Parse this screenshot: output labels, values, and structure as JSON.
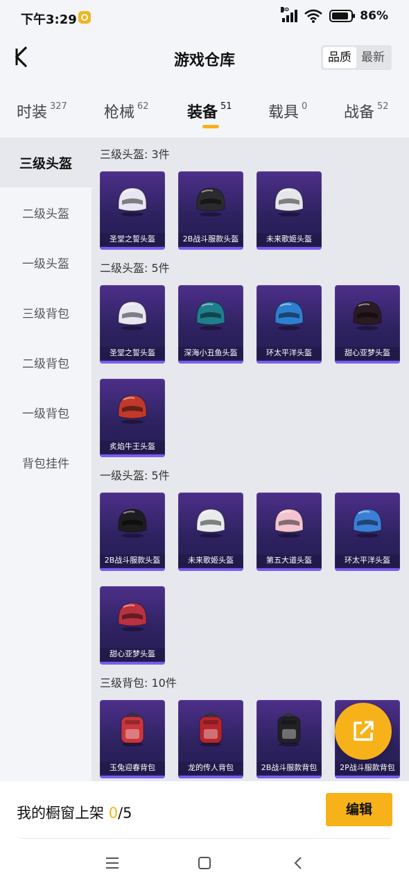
{
  "status_bar": {
    "time": "下午3:29",
    "battery": "86%"
  },
  "header": {
    "title": "游戏仓库",
    "sort_options": [
      "品质",
      "最新"
    ],
    "active_sort": "品质"
  },
  "category_tabs": [
    {
      "label": "时装",
      "count": "327"
    },
    {
      "label": "枪械",
      "count": "62"
    },
    {
      "label": "装备",
      "count": "51"
    },
    {
      "label": "载具",
      "count": "0"
    },
    {
      "label": "战备",
      "count": "52"
    }
  ],
  "sidebar": {
    "items": [
      "三级头盔",
      "二级头盔",
      "一级头盔",
      "三级背包",
      "二级背包",
      "一级背包",
      "背包挂件"
    ]
  },
  "sections": [
    {
      "title": "三级头盔: 3件",
      "items": [
        {
          "name": "圣堂之誓头盔",
          "icon": "helmet-icon",
          "color": "#e8e6f0"
        },
        {
          "name": "2B战斗服款头盔",
          "icon": "helmet-icon",
          "color": "#2b2b2e"
        },
        {
          "name": "未来歌姬头盔",
          "icon": "helmet-icon",
          "color": "#e4e6ea"
        }
      ]
    },
    {
      "title": "二级头盔: 5件",
      "items": [
        {
          "name": "圣堂之誓头盔",
          "icon": "helmet-icon",
          "color": "#e8e6f0"
        },
        {
          "name": "深海小丑鱼头盔",
          "icon": "helmet-icon",
          "color": "#1f7f8c"
        },
        {
          "name": "环太平洋头盔",
          "icon": "helmet-icon",
          "color": "#2f7fd0"
        },
        {
          "name": "甜心亚梦头盔",
          "icon": "helmet-icon",
          "color": "#2a1a22"
        },
        {
          "name": "炙焰牛王头盔",
          "icon": "helmet-icon",
          "color": "#c0392b"
        }
      ]
    },
    {
      "title": "一级头盔: 5件",
      "items": [
        {
          "name": "2B战斗服款头盔",
          "icon": "helmet-icon",
          "color": "#1d1d1f"
        },
        {
          "name": "未来歌姬头盔",
          "icon": "helmet-icon",
          "color": "#e9eaec"
        },
        {
          "name": "第五大道头盔",
          "icon": "helmet-icon",
          "color": "#f3c4cf"
        },
        {
          "name": "环太平洋头盔",
          "icon": "helmet-icon",
          "color": "#3b7ed6"
        },
        {
          "name": "甜心亚梦头盔",
          "icon": "helmet-icon",
          "color": "#b83241"
        }
      ]
    },
    {
      "title": "三级背包: 10件",
      "items": [
        {
          "name": "玉兔迎春背包",
          "icon": "backpack-icon",
          "color": "#c9363c"
        },
        {
          "name": "龙的传人背包",
          "icon": "backpack-icon",
          "color": "#b5262c"
        },
        {
          "name": "2B战斗服款背包",
          "icon": "backpack-icon",
          "color": "#222226"
        },
        {
          "name": "2P战斗服款背包",
          "icon": "backpack-icon",
          "color": "#e0b64a"
        }
      ]
    }
  ],
  "bottom": {
    "showcase_label": "我的橱窗上架",
    "showcase_current": "0",
    "showcase_total": "/5",
    "edit_label": "编辑"
  },
  "colors": {
    "accent": "#f7b21a",
    "card_bg": "#2e2260",
    "page_bg": "#f3f5f9",
    "content_bg": "#e6e8ed"
  }
}
